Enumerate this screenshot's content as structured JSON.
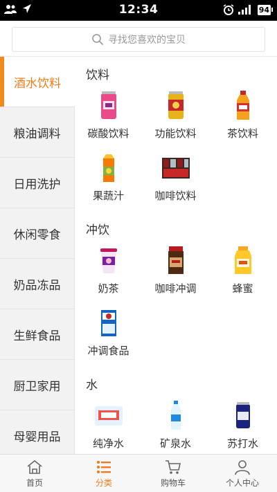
{
  "status_bar": {
    "time": "12:34",
    "battery": "94"
  },
  "search": {
    "placeholder": "寻找您喜欢的宝贝"
  },
  "sidebar": {
    "items": [
      {
        "label": "酒水饮料",
        "active": true
      },
      {
        "label": "粮油调料"
      },
      {
        "label": "日用洗护"
      },
      {
        "label": "休闲零食"
      },
      {
        "label": "奶品冻品"
      },
      {
        "label": "生鲜食品"
      },
      {
        "label": "厨卫家用"
      },
      {
        "label": "母婴用品"
      }
    ]
  },
  "content": {
    "sections": [
      {
        "title": "饮料",
        "items": [
          {
            "label": "碳酸饮料",
            "icon": "soda-can-icon"
          },
          {
            "label": "功能饮料",
            "icon": "energy-drink-can-icon"
          },
          {
            "label": "茶饮料",
            "icon": "tea-bottle-icon"
          },
          {
            "label": "果蔬汁",
            "icon": "juice-carton-icon"
          },
          {
            "label": "咖啡饮料",
            "icon": "coffee-cans-pack-icon"
          }
        ]
      },
      {
        "title": "冲饮",
        "items": [
          {
            "label": "奶茶",
            "icon": "milk-tea-cup-icon"
          },
          {
            "label": "咖啡冲调",
            "icon": "coffee-jar-icon"
          },
          {
            "label": "蜂蜜",
            "icon": "honey-jar-icon"
          },
          {
            "label": "冲调食品",
            "icon": "oatmeal-box-icon"
          }
        ]
      },
      {
        "title": "水",
        "items": [
          {
            "label": "纯净水",
            "icon": "water-pack-icon"
          },
          {
            "label": "矿泉水",
            "icon": "water-bottle-icon"
          },
          {
            "label": "苏打水",
            "icon": "soda-water-can-icon"
          }
        ]
      }
    ]
  },
  "bottom_nav": {
    "items": [
      {
        "label": "首页",
        "icon": "home-icon"
      },
      {
        "label": "分类",
        "icon": "category-list-icon",
        "active": true
      },
      {
        "label": "购物车",
        "icon": "cart-icon"
      },
      {
        "label": "个人中心",
        "icon": "user-icon"
      }
    ]
  },
  "colors": {
    "accent": "#ee7c1a",
    "sidebar_bg": "#f2f2f2"
  }
}
